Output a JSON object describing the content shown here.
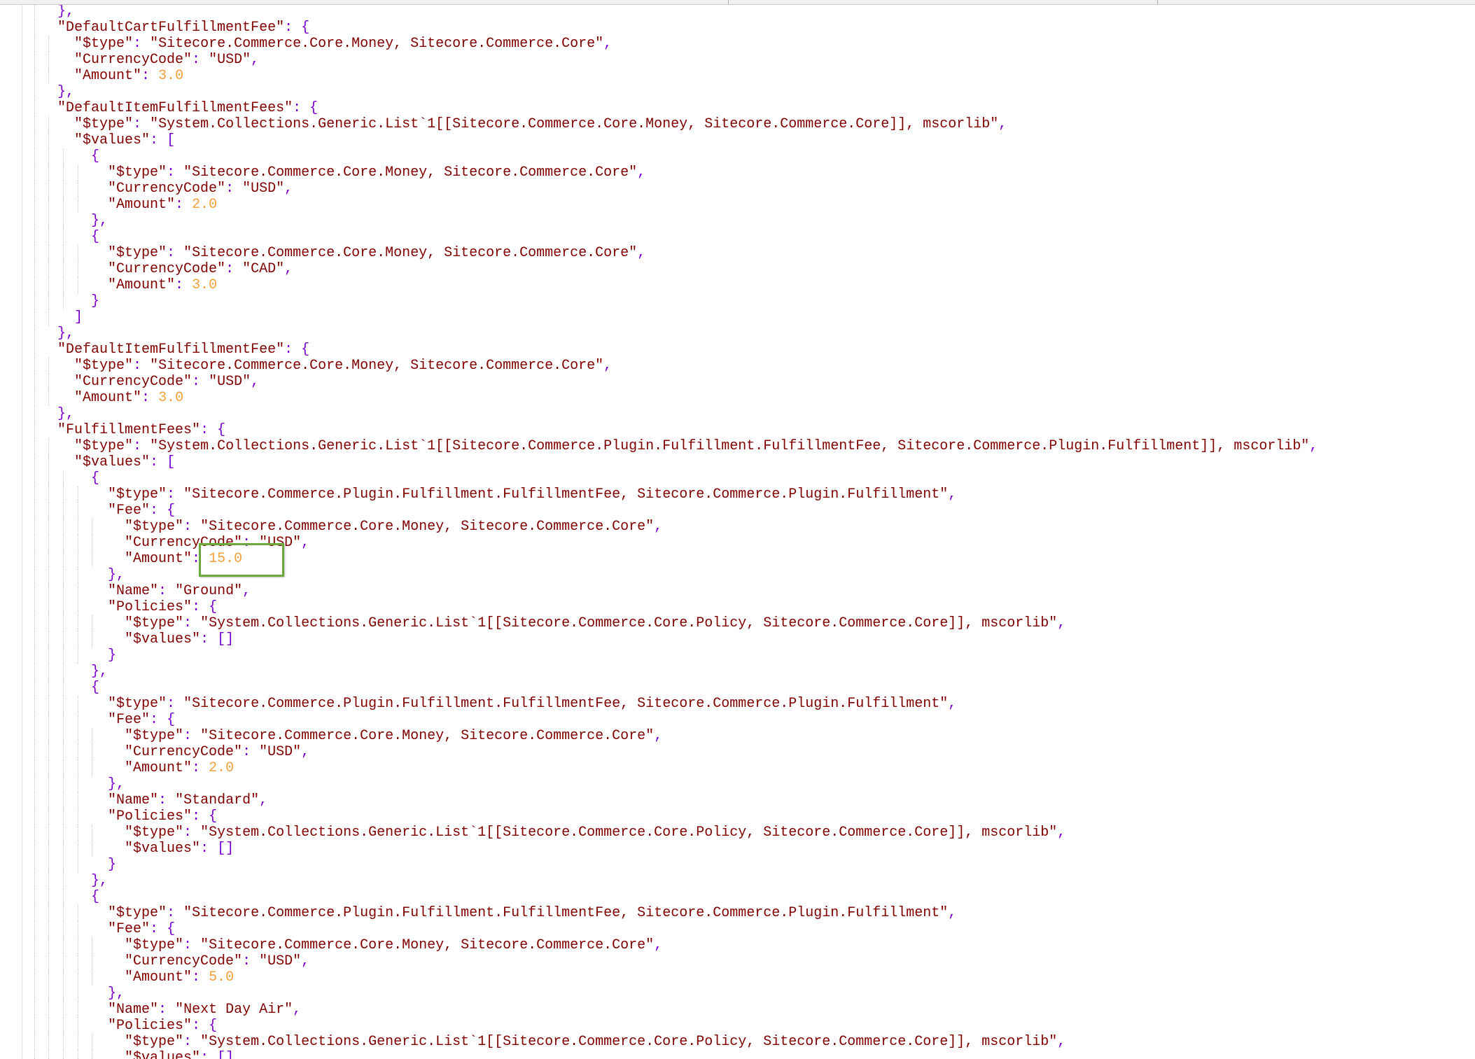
{
  "lines": [
    "    },",
    "    \"DefaultCartFulfillmentFee\": {",
    "      \"$type\": \"Sitecore.Commerce.Core.Money, Sitecore.Commerce.Core\",",
    "      \"CurrencyCode\": \"USD\",",
    "      \"Amount\": 3.0",
    "    },",
    "    \"DefaultItemFulfillmentFees\": {",
    "      \"$type\": \"System.Collections.Generic.List`1[[Sitecore.Commerce.Core.Money, Sitecore.Commerce.Core]], mscorlib\",",
    "      \"$values\": [",
    "        {",
    "          \"$type\": \"Sitecore.Commerce.Core.Money, Sitecore.Commerce.Core\",",
    "          \"CurrencyCode\": \"USD\",",
    "          \"Amount\": 2.0",
    "        },",
    "        {",
    "          \"$type\": \"Sitecore.Commerce.Core.Money, Sitecore.Commerce.Core\",",
    "          \"CurrencyCode\": \"CAD\",",
    "          \"Amount\": 3.0",
    "        }",
    "      ]",
    "    },",
    "    \"DefaultItemFulfillmentFee\": {",
    "      \"$type\": \"Sitecore.Commerce.Core.Money, Sitecore.Commerce.Core\",",
    "      \"CurrencyCode\": \"USD\",",
    "      \"Amount\": 3.0",
    "    },",
    "    \"FulfillmentFees\": {",
    "      \"$type\": \"System.Collections.Generic.List`1[[Sitecore.Commerce.Plugin.Fulfillment.FulfillmentFee, Sitecore.Commerce.Plugin.Fulfillment]], mscorlib\",",
    "      \"$values\": [",
    "        {",
    "          \"$type\": \"Sitecore.Commerce.Plugin.Fulfillment.FulfillmentFee, Sitecore.Commerce.Plugin.Fulfillment\",",
    "          \"Fee\": {",
    "            \"$type\": \"Sitecore.Commerce.Core.Money, Sitecore.Commerce.Core\",",
    "            \"CurrencyCode\": \"USD\",",
    "            \"Amount\": 15.0",
    "          },",
    "          \"Name\": \"Ground\",",
    "          \"Policies\": {",
    "            \"$type\": \"System.Collections.Generic.List`1[[Sitecore.Commerce.Core.Policy, Sitecore.Commerce.Core]], mscorlib\",",
    "            \"$values\": []",
    "          }",
    "        },",
    "        {",
    "          \"$type\": \"Sitecore.Commerce.Plugin.Fulfillment.FulfillmentFee, Sitecore.Commerce.Plugin.Fulfillment\",",
    "          \"Fee\": {",
    "            \"$type\": \"Sitecore.Commerce.Core.Money, Sitecore.Commerce.Core\",",
    "            \"CurrencyCode\": \"USD\",",
    "            \"Amount\": 2.0",
    "          },",
    "          \"Name\": \"Standard\",",
    "          \"Policies\": {",
    "            \"$type\": \"System.Collections.Generic.List`1[[Sitecore.Commerce.Core.Policy, Sitecore.Commerce.Core]], mscorlib\",",
    "            \"$values\": []",
    "          }",
    "        },",
    "        {",
    "          \"$type\": \"Sitecore.Commerce.Plugin.Fulfillment.FulfillmentFee, Sitecore.Commerce.Plugin.Fulfillment\",",
    "          \"Fee\": {",
    "            \"$type\": \"Sitecore.Commerce.Core.Money, Sitecore.Commerce.Core\",",
    "            \"CurrencyCode\": \"USD\",",
    "            \"Amount\": 5.0",
    "          },",
    "          \"Name\": \"Next Day Air\",",
    "          \"Policies\": {",
    "            \"$type\": \"System.Collections.Generic.List`1[[Sitecore.Commerce.Core.Policy, Sitecore.Commerce.Core]], mscorlib\",",
    "            \"$values\": []"
  ],
  "colors": {
    "key": "#800000",
    "string": "#800000",
    "number": "#f2a13c",
    "punctuation": "#7b00d4",
    "highlight_border": "#6aa83a"
  }
}
